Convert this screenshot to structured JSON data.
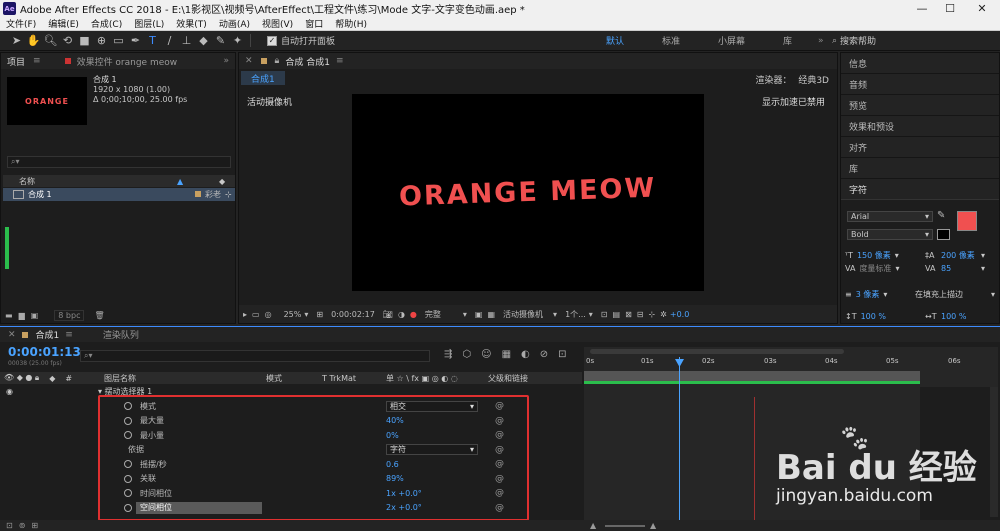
{
  "window": {
    "title": "Adobe After Effects CC 2018 - E:\\1影视区\\视频号\\AfterEffect\\工程文件\\练习\\Mode 文字-文字变色动画.aep *",
    "logo": "Ae",
    "minimize": "—",
    "maximize": "☐",
    "close": "✕"
  },
  "menu": [
    "文件(F)",
    "编辑(E)",
    "合成(C)",
    "图层(L)",
    "效果(T)",
    "动画(A)",
    "视图(V)",
    "窗口",
    "帮助(H)"
  ],
  "toolbar": {
    "auto_open_panels": "自动打开面板"
  },
  "workspaces": [
    "默认",
    "标准",
    "小屏幕",
    "库"
  ],
  "search_help": "搜索帮助",
  "project": {
    "tab_label": "项目",
    "effects_tab": "效果控件 orange meow",
    "thumbnail_text": "ORANGE",
    "comp_name": "合成 1",
    "comp_info_1": "1920 x 1080 (1.00)",
    "comp_info_2": "Δ 0;00;10;00, 25.00 fps",
    "col_name": "名称",
    "item_name": "合成 1",
    "item_type": "彩老",
    "bpc": "8 bpc"
  },
  "composition": {
    "tab_label": "合成 合成1",
    "breadcrumb": "合成1",
    "renderer_label": "渲染器：",
    "renderer_value": "经典3D",
    "camera_label": "活动摄像机",
    "accel_label": "显示加速已禁用",
    "canvas_text": "ORANGE MEOW",
    "zoom": "25%",
    "timecode": "0:00:02:17",
    "quality": "完整",
    "view": "活动摄像机",
    "views": "1个...",
    "offset": "+0.0"
  },
  "right_panels": [
    "信息",
    "音频",
    "预览",
    "效果和预设",
    "对齐",
    "库"
  ],
  "character": {
    "title": "字符",
    "font": "Arial",
    "style": "Bold",
    "size": "150 像素",
    "leading": "200 像素",
    "kerning": "度量标准",
    "tracking": "85",
    "stroke_width": "3 像素",
    "stroke_type": "在填充上描边",
    "vscale": "100 %",
    "hscale": "100 %",
    "fill_color": "#f05050"
  },
  "timeline": {
    "tab_label": "合成1",
    "render_queue": "渲染队列",
    "timecode": "0:00:01:13",
    "frames": "00038 (25.00 fps)",
    "col_layer_name": "图层名称",
    "col_mode": "模式",
    "col_trkmat": "T  TrkMat",
    "col_switches": "单 ☆ \\ fx ▣ ◎ ◐ ◌",
    "col_parent": "父级和链接",
    "selector": "▾ 摆动选择器 1",
    "ruler": [
      "0s",
      "01s",
      "02s",
      "03s",
      "04s",
      "05s",
      "06s"
    ],
    "props": [
      {
        "name": "模式",
        "value": "相交",
        "dropdown": true,
        "stopwatch": true
      },
      {
        "name": "最大量",
        "value": "40%",
        "dropdown": false,
        "stopwatch": true
      },
      {
        "name": "最小量",
        "value": "0%",
        "dropdown": false,
        "stopwatch": true
      },
      {
        "name": "依据",
        "value": "字符",
        "dropdown": true,
        "stopwatch": false
      },
      {
        "name": "摇摆/秒",
        "value": "0.6",
        "dropdown": false,
        "stopwatch": true
      },
      {
        "name": "关联",
        "value": "89%",
        "dropdown": false,
        "stopwatch": true
      },
      {
        "name": "时间相位",
        "value": "1x +0.0°",
        "dropdown": false,
        "stopwatch": true
      },
      {
        "name": "空间相位",
        "value": "2x +0.0°",
        "dropdown": false,
        "stopwatch": true
      }
    ]
  },
  "watermark": {
    "brand": "Bai du 经验",
    "url": "jingyan.baidu.com"
  },
  "colors": {
    "accent": "#4aa3ff",
    "highlight_box": "#e03030",
    "timeline_bar": "#2bbd4c"
  }
}
